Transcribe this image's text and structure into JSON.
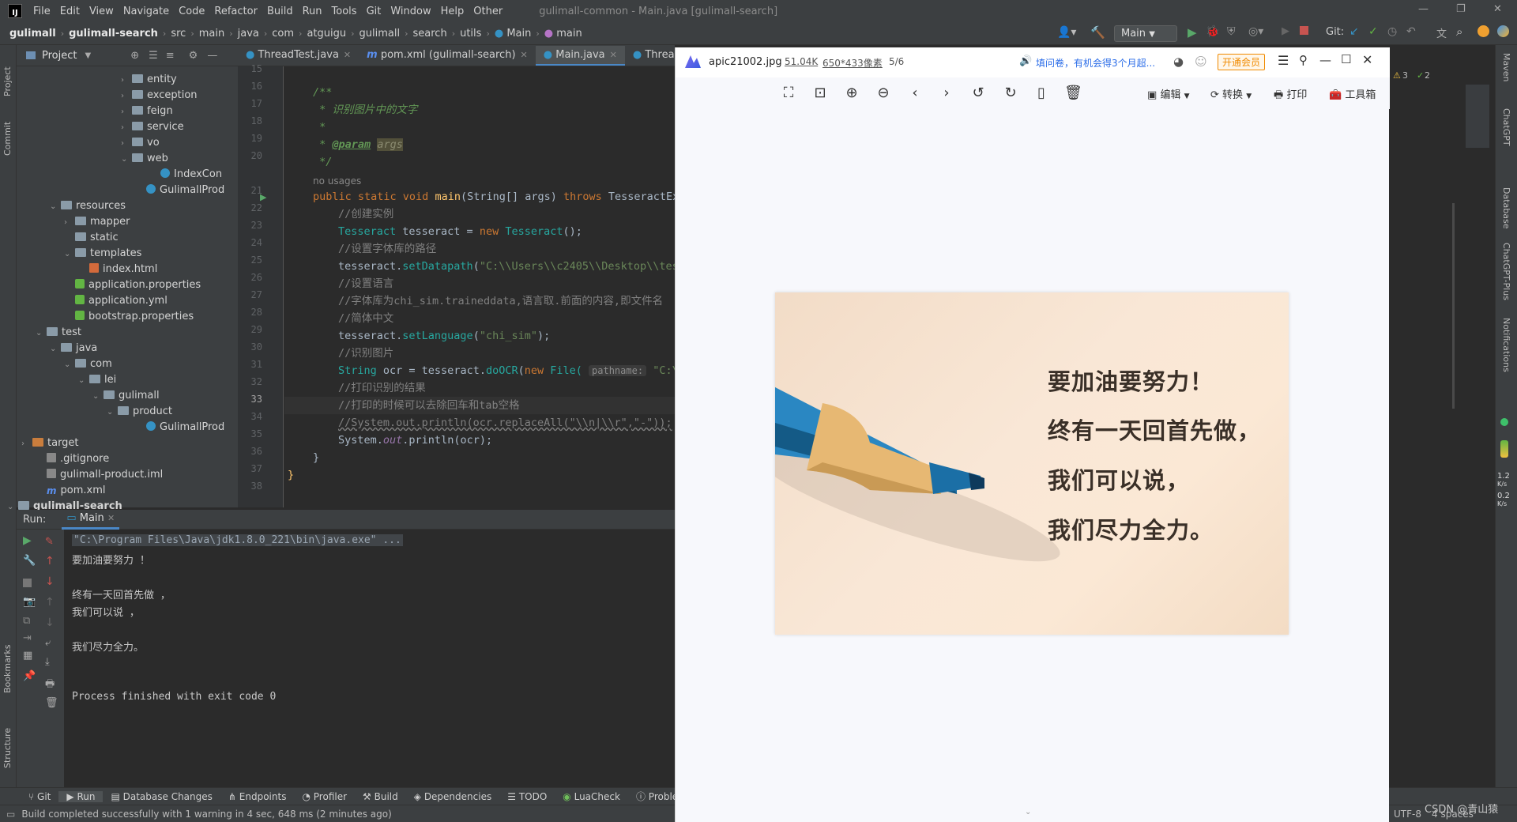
{
  "menubar": {
    "items": [
      "File",
      "Edit",
      "View",
      "Navigate",
      "Code",
      "Refactor",
      "Build",
      "Run",
      "Tools",
      "Git",
      "Window",
      "Help",
      "Other"
    ],
    "title": "gulimall-common - Main.java [gulimall-search]"
  },
  "navbar": {
    "crumbs": [
      "gulimall",
      "gulimall-search",
      "src",
      "main",
      "java",
      "com",
      "atguigu",
      "gulimall",
      "search",
      "utils",
      "Main",
      "main"
    ],
    "run_config": "Main",
    "git_label": "Git:"
  },
  "leftstrip": {
    "project": "Project",
    "commit": "Commit",
    "bookmarks": "Bookmarks",
    "structure": "Structure"
  },
  "project": {
    "title": "Project",
    "tree": [
      {
        "label": "entity",
        "type": "folder",
        "depth": 9,
        "arrow": "›"
      },
      {
        "label": "exception",
        "type": "folder",
        "depth": 9,
        "arrow": "›"
      },
      {
        "label": "feign",
        "type": "folder",
        "depth": 9,
        "arrow": "›"
      },
      {
        "label": "service",
        "type": "folder",
        "depth": 9,
        "arrow": "›"
      },
      {
        "label": "vo",
        "type": "folder",
        "depth": 9,
        "arrow": "›"
      },
      {
        "label": "web",
        "type": "folder",
        "depth": 9,
        "arrow": "⌄"
      },
      {
        "label": "IndexCon",
        "type": "class",
        "depth": 11,
        "arrow": ""
      },
      {
        "label": "GulimallProd",
        "type": "class",
        "depth": 10,
        "arrow": ""
      },
      {
        "label": "resources",
        "type": "folder",
        "depth": 4,
        "arrow": "⌄"
      },
      {
        "label": "mapper",
        "type": "folder",
        "depth": 5,
        "arrow": "›"
      },
      {
        "label": "static",
        "type": "folder",
        "depth": 5,
        "arrow": ""
      },
      {
        "label": "templates",
        "type": "folder",
        "depth": 5,
        "arrow": "⌄"
      },
      {
        "label": "index.html",
        "type": "html",
        "depth": 6,
        "arrow": ""
      },
      {
        "label": "application.properties",
        "type": "prop",
        "depth": 5,
        "arrow": ""
      },
      {
        "label": "application.yml",
        "type": "prop",
        "depth": 5,
        "arrow": ""
      },
      {
        "label": "bootstrap.properties",
        "type": "prop",
        "depth": 5,
        "arrow": ""
      },
      {
        "label": "test",
        "type": "folder",
        "depth": 3,
        "arrow": "⌄"
      },
      {
        "label": "java",
        "type": "folder",
        "depth": 4,
        "arrow": "⌄"
      },
      {
        "label": "com",
        "type": "folder",
        "depth": 5,
        "arrow": "⌄"
      },
      {
        "label": "lei",
        "type": "folder",
        "depth": 6,
        "arrow": "⌄"
      },
      {
        "label": "gulimall",
        "type": "folder",
        "depth": 7,
        "arrow": "⌄"
      },
      {
        "label": "product",
        "type": "folder",
        "depth": 8,
        "arrow": "⌄"
      },
      {
        "label": "GulimallProd",
        "type": "class",
        "depth": 10,
        "arrow": ""
      },
      {
        "label": "target",
        "type": "folder-orange",
        "depth": 2,
        "arrow": "›"
      },
      {
        "label": ".gitignore",
        "type": "git",
        "depth": 3,
        "arrow": ""
      },
      {
        "label": "gulimall-product.iml",
        "type": "git",
        "depth": 3,
        "arrow": ""
      },
      {
        "label": "pom.xml",
        "type": "xml",
        "depth": 3,
        "arrow": ""
      },
      {
        "label": "gulimall-search",
        "type": "folder",
        "depth": 1,
        "arrow": "⌄"
      }
    ]
  },
  "tabs": [
    {
      "label": "ThreadTest.java",
      "active": false
    },
    {
      "label": "pom.xml (gulimall-search)",
      "active": false
    },
    {
      "label": "Main.java",
      "active": true
    },
    {
      "label": "ThreadPoolEx",
      "active": false
    }
  ],
  "editor": {
    "line_numbers": [
      "15",
      "16",
      "17",
      "18",
      "19",
      "20",
      "",
      "21",
      "22",
      "23",
      "24",
      "25",
      "26",
      "27",
      "28",
      "29",
      "30",
      "31",
      "32",
      "33",
      "34",
      "35",
      "36",
      "37",
      "38"
    ],
    "no_usages": "no usages",
    "lines": {
      "l16": "/**",
      "l17": " * 识别图片中的文字",
      "l18": " *",
      "l19a": " * ",
      "l19b": "@param",
      "l19c": "args",
      "l20": " */",
      "l21a": "public static void ",
      "l21b": "main",
      "l21c": "(String[] args) ",
      "l21d": "throws ",
      "l21e": "TesseractEx",
      "l22": "//创建实例",
      "l23a": "Tesseract",
      "l23b": " tesseract = ",
      "l23c": "new ",
      "l23d": "Tesseract",
      "l23e": "();",
      "l24": "//设置字体库的路径",
      "l25a": "tesseract.",
      "l25b": "setDatapath",
      "l25c": "(",
      "l25d": "\"C:\\\\Users\\\\c2405\\\\Desktop\\\\tes",
      "l26": "//设置语言",
      "l27": "//字体库为chi_sim.traineddata,语言取.前面的内容,即文件名",
      "l28": "//简体中文",
      "l29a": "tesseract.",
      "l29b": "setLanguage",
      "l29c": "(",
      "l29d": "\"chi_sim\"",
      "l29e": ");",
      "l30": "//识别图片",
      "l31a": "String",
      "l31b": " ocr = tesseract.",
      "l31c": "doOCR",
      "l31d": "(",
      "l31e": "new ",
      "l31f": "File(",
      "l31g": "pathname:",
      "l31h": " \"C:\\\\U",
      "l32": "//打印识别的结果",
      "l33": "//打印的时候可以去除回车和tab空格",
      "l34": "//System.out.println(ocr.replaceAll(\"\\\\n|\\\\r\",\"-\"));",
      "l35a": "System.",
      "l35b": "out",
      "l35c": ".println(ocr);",
      "l36": "}",
      "l37": "}"
    }
  },
  "run": {
    "label": "Run:",
    "tab": "Main",
    "output": [
      "\"C:\\Program Files\\Java\\jdk1.8.0_221\\bin\\java.exe\" ...",
      "要加油要努力 ！",
      "",
      "终有一天回首先做 ，",
      "我们可以说 ，",
      "",
      "我们尽力全力。",
      "",
      "",
      "",
      "Process finished with exit code 0"
    ]
  },
  "rightstrip": {
    "maven": "Maven",
    "chatgpt": "ChatGPT",
    "database": "Database",
    "chatgptplus": "ChatGPT-Plus",
    "notifications": "Notifications",
    "speed1": "1.2",
    "speed1u": "K/s",
    "speed2": "0.2",
    "speed2u": "K/s",
    "warn_count": "3",
    "ok_count": "2"
  },
  "bottom_tools": [
    "Git",
    "Run",
    "Database Changes",
    "Endpoints",
    "Profiler",
    "Build",
    "Dependencies",
    "TODO",
    "LuaCheck",
    "Problems"
  ],
  "status": {
    "message": "Build completed successfully with 1 warning in 4 sec, 648 ms (2 minutes ago)",
    "encoding": "UTF-8",
    "indent": "4 spaces",
    "watermark": "CSDN @青山猿"
  },
  "viewer": {
    "filename": "apic21002.jpg",
    "fileinfo": "51.04K",
    "dims": "650*433像素",
    "index": "5/6",
    "ad": "填问卷，有机会得3个月超...",
    "vip": "开通会员",
    "edit": "编辑",
    "convert": "转换",
    "print": "打印",
    "toolbox": "工具箱",
    "image_text": [
      "要加油要努力！",
      "终有一天回首先做，",
      "我们可以说，",
      "我们尽力全力。"
    ]
  },
  "colors": {
    "accent": "#4a88c7",
    "ide_bg": "#2b2b2b",
    "panel_bg": "#3c3f41",
    "vip_orange": "#f08a00"
  }
}
